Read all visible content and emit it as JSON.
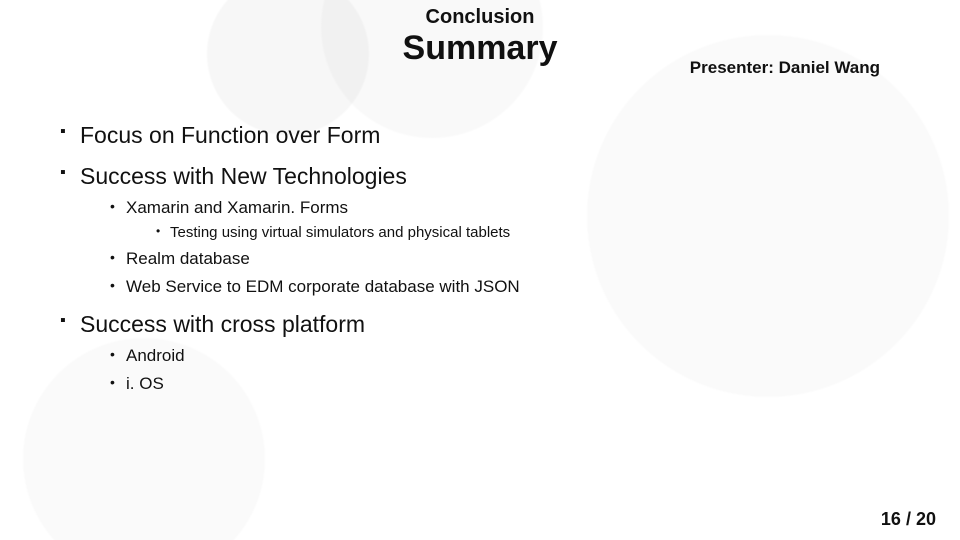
{
  "header": {
    "supertitle": "Conclusion",
    "title": "Summary"
  },
  "presenter_label": "Presenter: Daniel Wang",
  "bullets": {
    "lvl1": [
      "Focus on Function over Form",
      "Success with New Technologies",
      "Success with cross platform"
    ],
    "tech_sub": [
      "Xamarin and Xamarin. Forms",
      "Realm database",
      "Web Service to EDM corporate database with JSON"
    ],
    "xamarin_sub": [
      "Testing using virtual simulators and physical tablets"
    ],
    "platform_sub": [
      "Android",
      "i. OS"
    ]
  },
  "page": {
    "current": "16",
    "sep": " / ",
    "total": "20"
  }
}
